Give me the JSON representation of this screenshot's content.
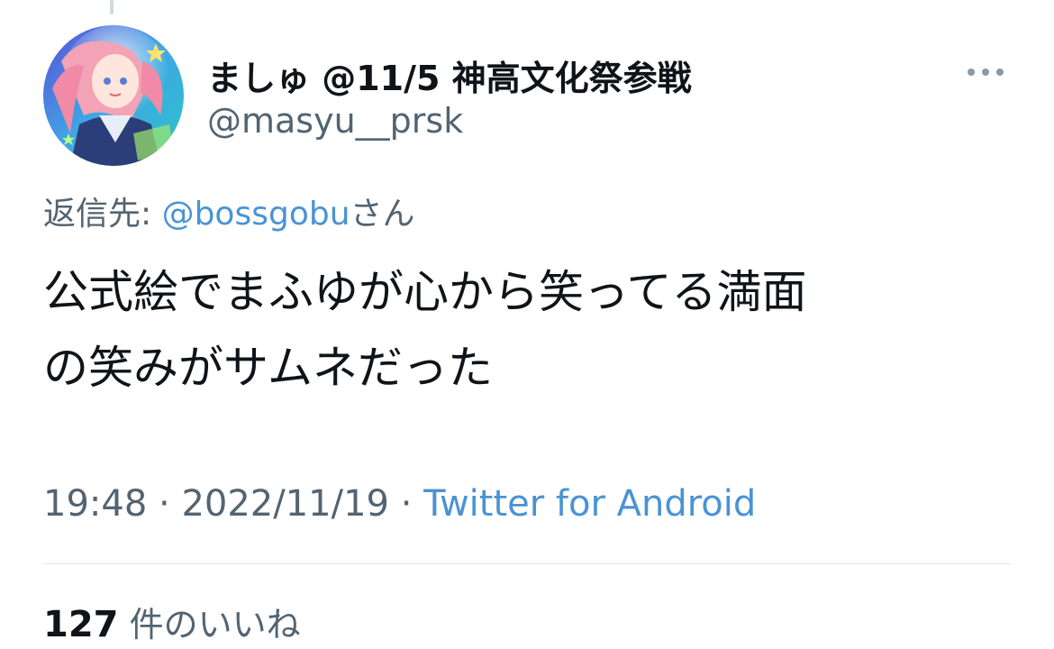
{
  "author": {
    "display_name": "ましゅ @11/5 神高文化祭参戦",
    "handle": "@masyu__prsk",
    "avatar_icon": "anime-character-avatar"
  },
  "reply": {
    "prefix": "返信先: ",
    "mention": "@bossgobu",
    "suffix": "さん"
  },
  "tweet": {
    "line1": "公式絵でまふゆが心から笑ってる満面",
    "line2": "の笑みがサムネだった"
  },
  "meta": {
    "time": "19:48",
    "separator1": " · ",
    "date": "2022/11/19",
    "separator2": " · ",
    "source": "Twitter for Android"
  },
  "stats": {
    "likes_count": "127",
    "likes_label": "件のいいね"
  },
  "icons": {
    "more": "more-horizontal-icon"
  },
  "colors": {
    "text_primary": "#0f1419",
    "text_secondary": "#536471",
    "link": "#4a93d4"
  }
}
